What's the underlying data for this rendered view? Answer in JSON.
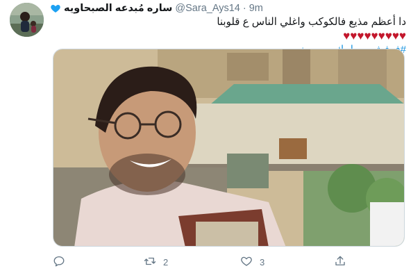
{
  "tweet": {
    "author": {
      "display_name": "ساره مُبدعه الصبحاويه",
      "verified_heart": "blue-heart-icon",
      "handle": "@Sara_Ays14",
      "separator": "·",
      "time": "9m"
    },
    "text_line1": "دا أعظم مذيع فالكوكب واغلي الناس ع قلوبنا",
    "hearts": "♥♥♥♥♥♥♥♥♥",
    "hashtag": "#فرفش_صباحك_مع_يونس",
    "media": {
      "icon": "photo-man-smiling"
    },
    "actions": {
      "reply": {
        "icon": "reply-icon",
        "count": ""
      },
      "retweet": {
        "icon": "retweet-icon",
        "count": "2"
      },
      "like": {
        "icon": "like-icon",
        "count": "3"
      },
      "share": {
        "icon": "share-icon",
        "count": ""
      }
    }
  },
  "colors": {
    "text": "#14171a",
    "muted": "#657786",
    "link": "#1b95e0",
    "heart": "#c3172c",
    "accent_blue_heart": "#1da1f2"
  }
}
